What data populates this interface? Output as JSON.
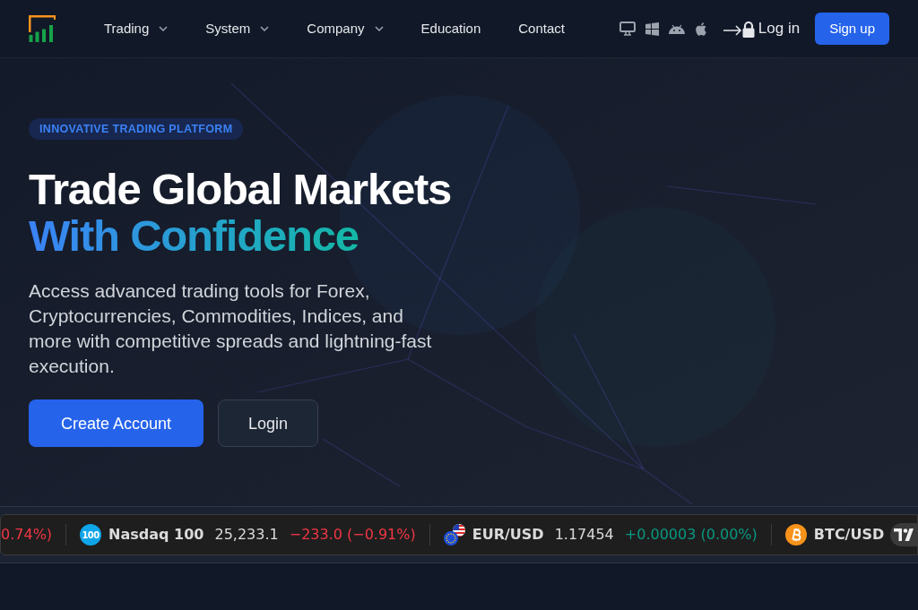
{
  "header": {
    "nav": [
      {
        "label": "Trading",
        "dropdown": true
      },
      {
        "label": "System",
        "dropdown": true
      },
      {
        "label": "Company",
        "dropdown": true
      },
      {
        "label": "Education",
        "dropdown": false
      },
      {
        "label": "Contact",
        "dropdown": false
      }
    ],
    "platforms": [
      {
        "kind": "desktop"
      },
      {
        "kind": "windows"
      },
      {
        "kind": "android"
      },
      {
        "kind": "apple"
      }
    ],
    "login": "Log in",
    "signup": "Sign up"
  },
  "hero": {
    "badge": "INNOVATIVE TRADING PLATFORM",
    "title": "Trade Global Markets",
    "title_highlight": "With Confidence",
    "description": "Access advanced trading tools for Forex, Cryptocurrencies, Commodities, Indices, and more with competitive spreads and lightning-fast execution.",
    "buttons": [
      {
        "label": "Create Account",
        "kind": "primary"
      },
      {
        "label": "Login",
        "kind": "secondary"
      }
    ]
  },
  "ticker": [
    {
      "change": "0.74%)",
      "color": "#f23645"
    },
    {
      "kind": "index",
      "logo_text": "100",
      "symbol": "Nasdaq 100",
      "price": "25,233.1",
      "change": "−233.0 (−0.91%)",
      "color": "#f23645"
    },
    {
      "kind": "forex",
      "symbol": "EUR/USD",
      "price": "1.17454",
      "change": "+0.00003 (0.00%)",
      "color": "#089981"
    },
    {
      "kind": "crypto",
      "symbol": "BTC/USD"
    }
  ]
}
